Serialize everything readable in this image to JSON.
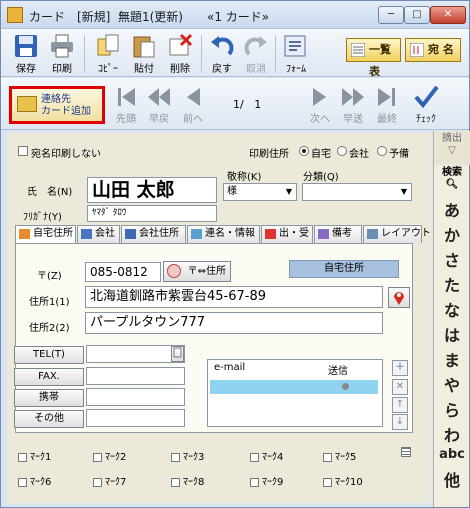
{
  "window": {
    "title": "カード　[新規]  無題1(更新)　　«1 カード»",
    "min": "─",
    "max": "□",
    "close": "✕"
  },
  "toolbar": {
    "save": "保存",
    "print": "印刷",
    "copy": "ｺﾋﾟｰ",
    "paste": "貼付",
    "delete": "削除",
    "undo": "戻す",
    "cancel": "取消",
    "form": "ﾌｫｰﾑ",
    "list": "一覧表",
    "address": "宛 名"
  },
  "nav": {
    "add_l1": "連絡先",
    "add_l2": "カード追加",
    "first": "先頭",
    "prev_fast": "早戻",
    "prev": "前へ",
    "page": "1/   1",
    "next": "次へ",
    "next_fast": "早送",
    "last": "最終",
    "check": "ﾁｪｯｸ"
  },
  "form": {
    "no_print": "宛名印刷しない",
    "print_addr_label": "印刷住所",
    "print_addr_opts": [
      "自宅",
      "会社",
      "予備"
    ],
    "honorific_label": "敬称(K)",
    "honorific_value": "様",
    "category_label": "分類(Q)",
    "category_value": "",
    "name_label": "氏　名(N)",
    "name_value": "山田 太郎",
    "kana_label": "ﾌﾘｶﾞﾅ(Y)",
    "kana_value": "ﾔﾏﾀﾞ ﾀﾛｳ"
  },
  "tabs": [
    "自宅住所",
    "会社",
    "会社住所",
    "連名・情報",
    "出・受",
    "備考",
    "レイアウト"
  ],
  "home": {
    "header": "自宅住所",
    "zip_label": "〒(Z)",
    "zip_value": "085-0812",
    "zip_btn": "〒⇔住所",
    "addr1_label": "住所1(1)",
    "addr1_value": "北海道釧路市紫雲台45-67-89",
    "addr2_label": "住所2(2)",
    "addr2_value": "パープルタウン777",
    "tel": "TEL(T)",
    "fax": "FAX.",
    "mobile": "携帯",
    "other": "その他",
    "email_col": "e-mail",
    "send_col": "送信"
  },
  "marks": [
    "ﾏｰｸ1",
    "ﾏｰｸ2",
    "ﾏｰｸ3",
    "ﾏｰｸ4",
    "ﾏｰｸ5",
    "ﾏｰｸ6",
    "ﾏｰｸ7",
    "ﾏｰｸ8",
    "ﾏｰｸ9",
    "ﾏｰｸ10"
  ],
  "sidebar": {
    "hdr1": "摘出",
    "search": "検索",
    "kana": [
      "あ",
      "か",
      "さ",
      "た",
      "な",
      "は",
      "ま",
      "や",
      "ら",
      "わ"
    ],
    "abc": "abc",
    "other": "他"
  }
}
